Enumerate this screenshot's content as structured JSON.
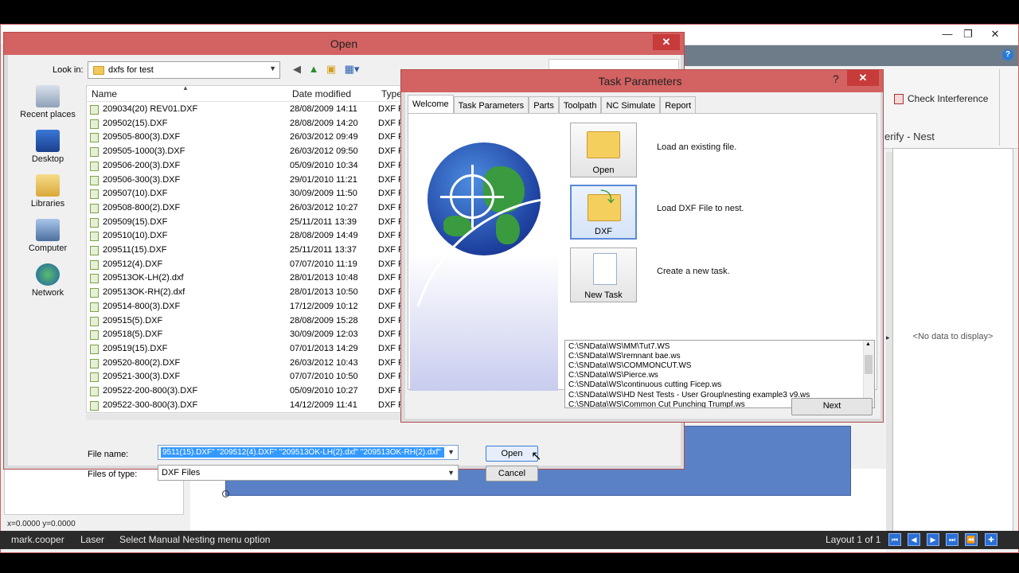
{
  "app": {
    "ribbon_button": "Check Interference",
    "section_label": "erify - Nest",
    "no_data": "<No data to display>",
    "coords": "x=0.0000 y=0.0000",
    "window_buttons": [
      "—",
      "❐",
      "✕"
    ],
    "help": "?"
  },
  "status": {
    "user": "mark.cooper",
    "machine": "Laser",
    "message": "Select Manual Nesting menu option",
    "layout": "Layout 1 of 1",
    "nav_buttons": [
      "⏮",
      "◀",
      "▶",
      "⏭",
      "⏪",
      "✚"
    ]
  },
  "open_dialog": {
    "title": "Open",
    "close": "✕",
    "look_in_label": "Look in:",
    "look_in_value": "dxfs for test",
    "places": [
      "Recent places",
      "Desktop",
      "Libraries",
      "Computer",
      "Network"
    ],
    "columns": {
      "name": "Name",
      "date": "Date modified",
      "type": "Type"
    },
    "files": [
      {
        "name": "209034(20) REV01.DXF",
        "date": "28/08/2009 14:11",
        "type": "DXF F"
      },
      {
        "name": "209502(15).DXF",
        "date": "28/08/2009 14:20",
        "type": "DXF F"
      },
      {
        "name": "209505-800(3).DXF",
        "date": "26/03/2012 09:49",
        "type": "DXF F"
      },
      {
        "name": "209505-1000(3).DXF",
        "date": "26/03/2012 09:50",
        "type": "DXF F"
      },
      {
        "name": "209506-200(3).DXF",
        "date": "05/09/2010 10:34",
        "type": "DXF F"
      },
      {
        "name": "209506-300(3).DXF",
        "date": "29/01/2010 11:21",
        "type": "DXF F"
      },
      {
        "name": "209507(10).DXF",
        "date": "30/09/2009 11:50",
        "type": "DXF F"
      },
      {
        "name": "209508-800(2).DXF",
        "date": "26/03/2012 10:27",
        "type": "DXF F"
      },
      {
        "name": "209509(15).DXF",
        "date": "25/11/2011 13:39",
        "type": "DXF F"
      },
      {
        "name": "209510(10).DXF",
        "date": "28/08/2009 14:49",
        "type": "DXF F"
      },
      {
        "name": "209511(15).DXF",
        "date": "25/11/2011 13:37",
        "type": "DXF F"
      },
      {
        "name": "209512(4).DXF",
        "date": "07/07/2010 11:19",
        "type": "DXF F"
      },
      {
        "name": "209513OK-LH(2).dxf",
        "date": "28/01/2013 10:48",
        "type": "DXF F"
      },
      {
        "name": "209513OK-RH(2).dxf",
        "date": "28/01/2013 10:50",
        "type": "DXF F"
      },
      {
        "name": "209514-800(3).DXF",
        "date": "17/12/2009 10:12",
        "type": "DXF F"
      },
      {
        "name": "209515(5).DXF",
        "date": "28/08/2009 15:28",
        "type": "DXF F"
      },
      {
        "name": "209518(5).DXF",
        "date": "30/09/2009 12:03",
        "type": "DXF F"
      },
      {
        "name": "209519(15).DXF",
        "date": "07/01/2013 14:29",
        "type": "DXF F"
      },
      {
        "name": "209520-800(2).DXF",
        "date": "26/03/2012 10:43",
        "type": "DXF F"
      },
      {
        "name": "209521-300(3).DXF",
        "date": "07/07/2010 10:50",
        "type": "DXF F"
      },
      {
        "name": "209522-200-800(3).DXF",
        "date": "05/09/2010 10:27",
        "type": "DXF F"
      },
      {
        "name": "209522-300-800(3).DXF",
        "date": "14/12/2009 11:41",
        "type": "DXF F"
      }
    ],
    "file_name_label": "File name:",
    "file_name_value": "9511(15).DXF\" \"209512(4).DXF\" \"209513OK-LH(2).dxf\" \"209513OK-RH(2).dxf\"",
    "files_of_type_label": "Files of type:",
    "files_of_type_value": "DXF Files",
    "open_button": "Open",
    "cancel_button": "Cancel"
  },
  "task_dialog": {
    "title": "Task Parameters",
    "help": "?",
    "close": "✕",
    "tabs": [
      "Welcome",
      "Task Parameters",
      "Parts",
      "Toolpath",
      "NC Simulate",
      "Report"
    ],
    "actions": [
      {
        "label": "Open",
        "desc": "Load an existing file."
      },
      {
        "label": "DXF",
        "desc": "Load DXF File to nest."
      },
      {
        "label": "New Task",
        "desc": "Create a new task."
      }
    ],
    "recent": [
      "C:\\SNData\\WS\\MM\\Tut7.WS",
      "C:\\SNData\\WS\\remnant bae.ws",
      "C:\\SNData\\WS\\COMMONCUT.WS",
      "C:\\SNData\\WS\\Pierce.ws",
      "C:\\SNData\\WS\\continuous cutting Ficep.ws",
      "C:\\SNData\\WS\\HD Nest Tests - User Group\\nesting example3 v9.ws",
      "C:\\SNData\\WS\\Common Cut Punching Trumpf.ws"
    ],
    "next_button": "Next"
  }
}
